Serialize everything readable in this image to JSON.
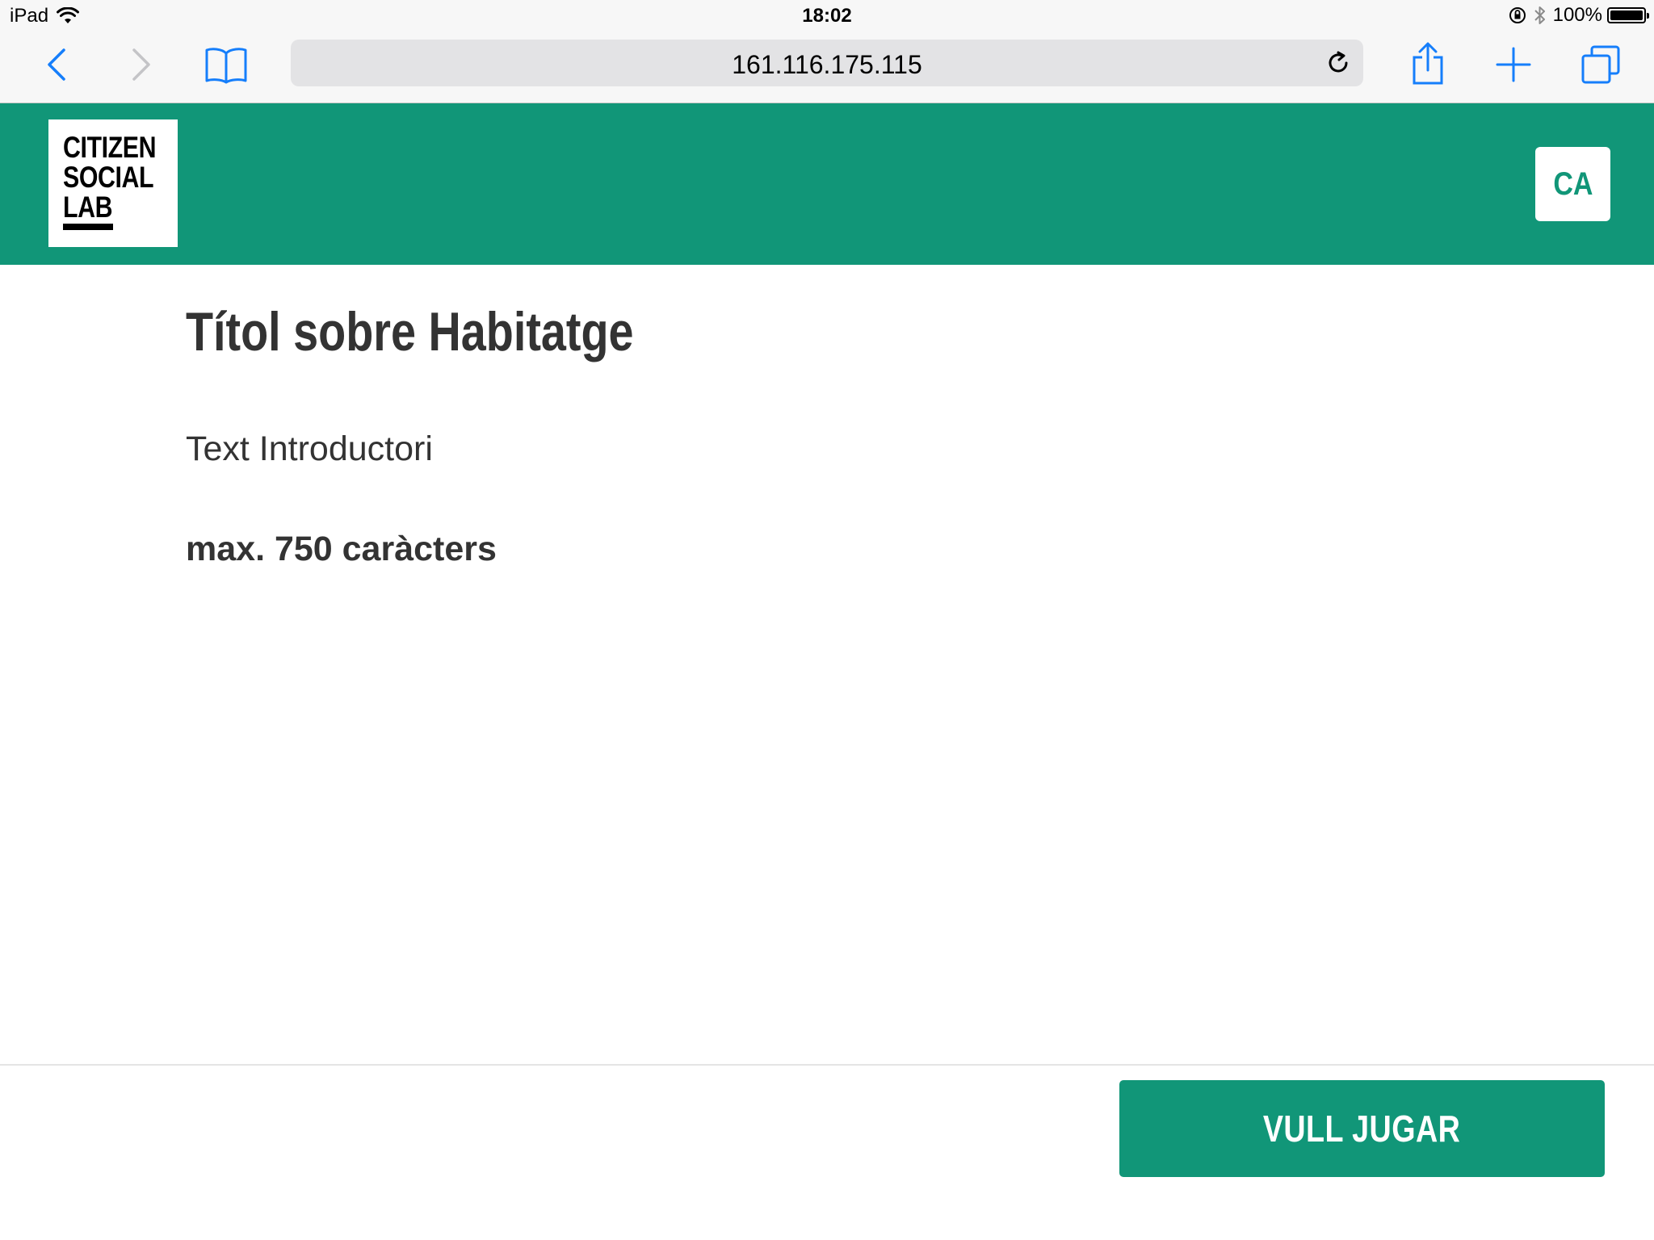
{
  "status_bar": {
    "device": "iPad",
    "time": "18:02",
    "battery": "100%",
    "battery_level": 1.0
  },
  "browser": {
    "url": "161.116.175.115",
    "icons": {
      "back": "chevron-left-icon",
      "forward": "chevron-right-icon",
      "bookmarks": "book-icon",
      "reload": "reload-icon",
      "share": "share-icon",
      "add": "plus-icon",
      "tabs": "tabs-icon"
    },
    "accent_color": "#157efb"
  },
  "header": {
    "logo_lines": [
      "CITIZEN",
      "SOCIAL",
      "LAB"
    ],
    "language": "CA",
    "brand_color": "#119678"
  },
  "main": {
    "title": "Títol sobre Habitatge",
    "intro": "Text Introductori",
    "limit_text": "max. 750 caràcters"
  },
  "footer": {
    "play_button": "VULL JUGAR"
  }
}
